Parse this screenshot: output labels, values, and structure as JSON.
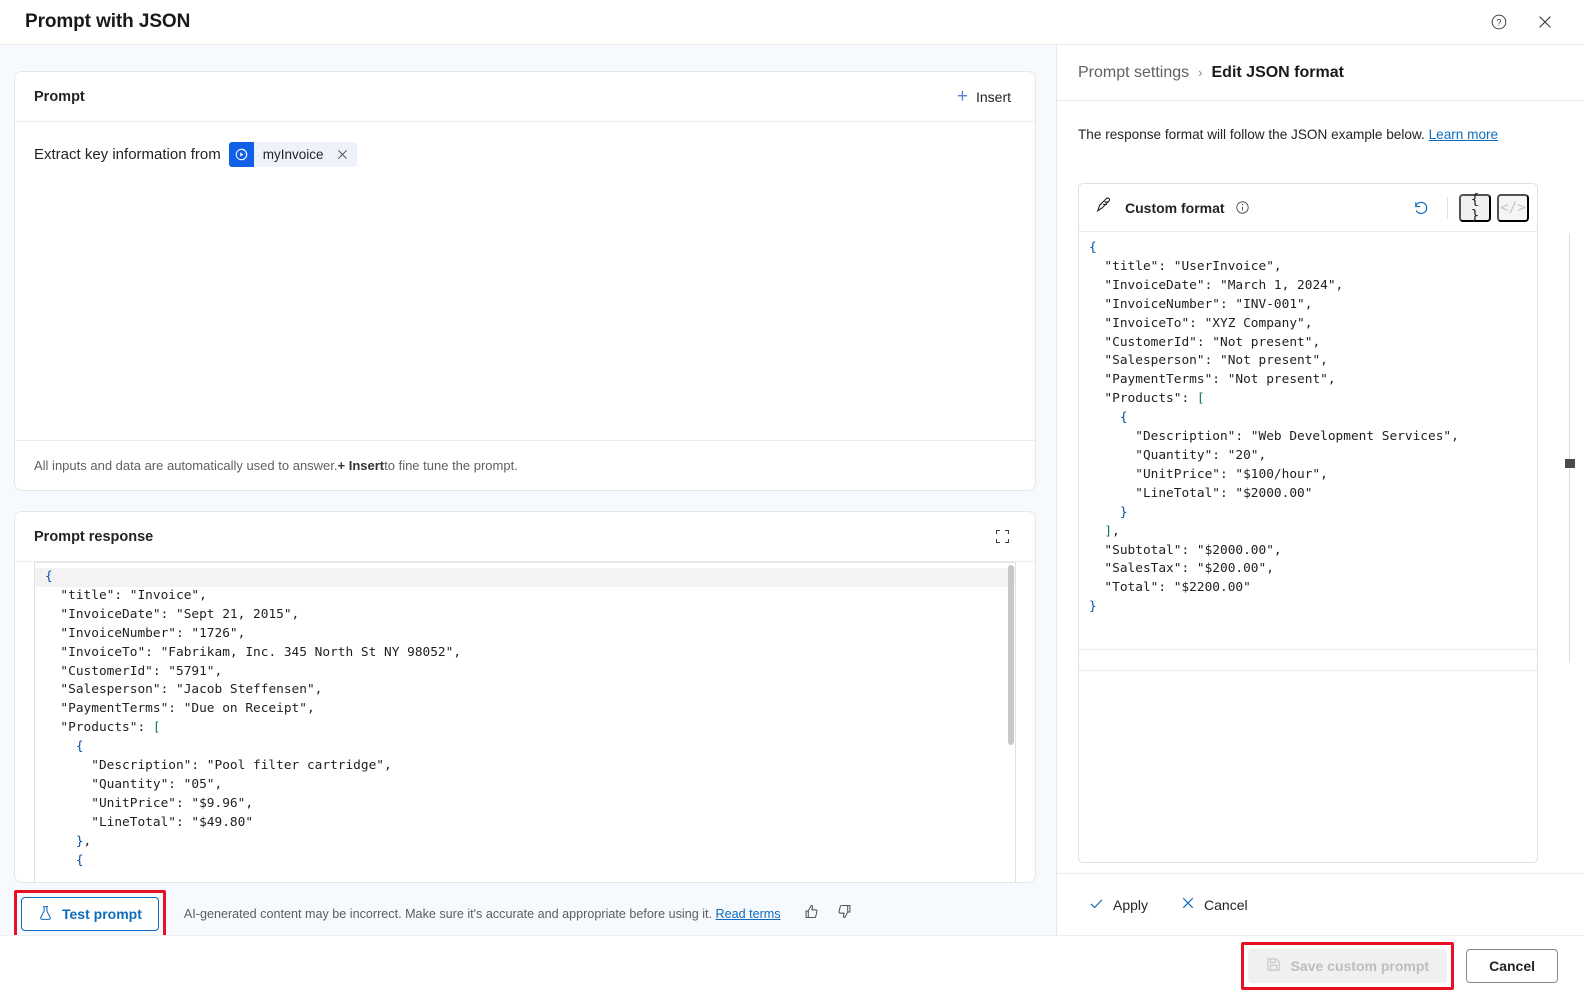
{
  "window": {
    "title": "Prompt with JSON",
    "help_icon": "question-circle-icon",
    "close_icon": "close-icon"
  },
  "left": {
    "prompt_card": {
      "title": "Prompt",
      "insert_label": "Insert",
      "prompt_text": "Extract key information from",
      "chip_label": "myInvoice",
      "footer_note_prefix": "All inputs and data are automatically used to answer. ",
      "footer_note_bold": "+ Insert",
      "footer_note_suffix": " to fine tune the prompt."
    },
    "response_card": {
      "title": "Prompt response",
      "expand_icon": "expand-icon",
      "code_lines": [
        "{",
        "  \"title\": \"Invoice\",",
        "  \"InvoiceDate\": \"Sept 21, 2015\",",
        "  \"InvoiceNumber\": \"1726\",",
        "  \"InvoiceTo\": \"Fabrikam, Inc. 345 North St NY 98052\",",
        "  \"CustomerId\": \"5791\",",
        "  \"Salesperson\": \"Jacob Steffensen\",",
        "  \"PaymentTerms\": \"Due on Receipt\",",
        "  \"Products\": [",
        "    {",
        "      \"Description\": \"Pool filter cartridge\",",
        "      \"Quantity\": \"05\",",
        "      \"UnitPrice\": \"$9.96\",",
        "      \"LineTotal\": \"$49.80\"",
        "    },",
        "    {"
      ]
    },
    "actions": {
      "test_prompt_label": "Test prompt",
      "test_prompt_icon": "flask-icon",
      "disclaimer_text": "AI-generated content may be incorrect. Make sure it's accurate and appropriate before using it. ",
      "read_terms_label": "Read terms",
      "thumbs_up_icon": "thumbs-up-icon",
      "thumbs_down_icon": "thumbs-down-icon"
    }
  },
  "right": {
    "breadcrumb": {
      "parent": "Prompt settings",
      "separator": "›",
      "current": "Edit JSON format"
    },
    "description": "The response format will follow the JSON example below. ",
    "learn_more_label": "Learn more",
    "format_card": {
      "edit_icon": "pen-edit-icon",
      "title": "Custom format",
      "info_icon": "info-circle-icon",
      "reset_icon": "reset-undo-icon",
      "json_view_label": "{ }",
      "code_view_label": "</>",
      "code_lines": [
        "{",
        "  \"title\": \"UserInvoice\",",
        "  \"InvoiceDate\": \"March 1, 2024\",",
        "  \"InvoiceNumber\": \"INV-001\",",
        "  \"InvoiceTo\": \"XYZ Company\",",
        "  \"CustomerId\": \"Not present\",",
        "  \"Salesperson\": \"Not present\",",
        "  \"PaymentTerms\": \"Not present\",",
        "  \"Products\": [",
        "    {",
        "      \"Description\": \"Web Development Services\",",
        "      \"Quantity\": \"20\",",
        "      \"UnitPrice\": \"$100/hour\",",
        "      \"LineTotal\": \"$2000.00\"",
        "    }",
        "  ],",
        "  \"Subtotal\": \"$2000.00\",",
        "  \"SalesTax\": \"$200.00\",",
        "  \"Total\": \"$2200.00\"",
        "}"
      ]
    },
    "footer": {
      "apply_label": "Apply",
      "apply_icon": "checkmark-icon",
      "cancel_label": "Cancel",
      "cancel_icon": "close-icon"
    }
  },
  "dialog_footer": {
    "save_label": "Save custom prompt",
    "save_icon": "save-floppy-icon",
    "cancel_label": "Cancel"
  },
  "colors": {
    "accent": "#0f6cbd",
    "chip_blue": "#1060e8",
    "highlight_red": "#e81123",
    "pane_bg": "#f6f9fd"
  }
}
